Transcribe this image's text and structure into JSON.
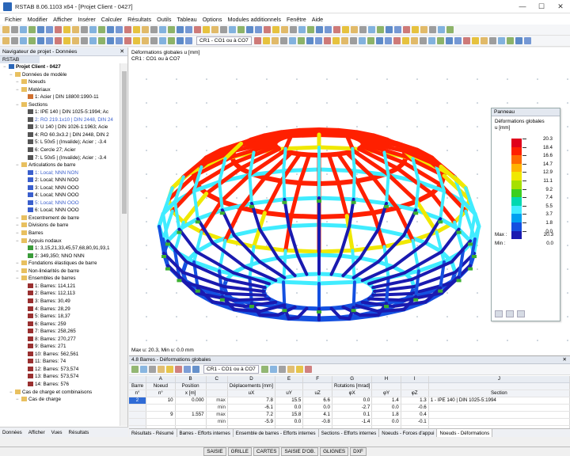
{
  "window": {
    "title": "RSTAB 8.06.1103 x64 - [Projet Client - 0427]"
  },
  "menu": [
    "Fichier",
    "Modifier",
    "Afficher",
    "Insérer",
    "Calculer",
    "Résultats",
    "Outils",
    "Tableau",
    "Options",
    "Modules additionnels",
    "Fenêtre",
    "Aide"
  ],
  "toolbar": {
    "loadcase_combo": "CR1 - CO1 ou à CO7"
  },
  "navigator": {
    "title": "Navigateur de projet - Données",
    "tab": "RSTAB",
    "tree": [
      {
        "depth": 0,
        "label": "Projet Client - 0427",
        "bold": true,
        "icon": "project"
      },
      {
        "depth": 1,
        "label": "Données de modèle",
        "icon": "folder"
      },
      {
        "depth": 2,
        "label": "Noeuds",
        "icon": "folder"
      },
      {
        "depth": 2,
        "label": "Matériaux",
        "icon": "folder"
      },
      {
        "depth": 3,
        "label": "1: Acier | DIN 18800:1990-11",
        "icon": "material"
      },
      {
        "depth": 2,
        "label": "Sections",
        "icon": "folder"
      },
      {
        "depth": 3,
        "label": "1: IPE 140 | DIN 1025-5:1994; Ac",
        "icon": "section"
      },
      {
        "depth": 3,
        "label": "2: RO 219.1x10 | DIN 2448, DIN 24",
        "icon": "section",
        "hl": true
      },
      {
        "depth": 3,
        "label": "3: U 140 | DIN 1026-1:1963; Acie",
        "icon": "section"
      },
      {
        "depth": 3,
        "label": "4: RO 60.3x3.2 | DIN 2448, DIN 2",
        "icon": "section"
      },
      {
        "depth": 3,
        "label": "5: L 50x5 | (Invalide); Acier ; -3.4",
        "icon": "section"
      },
      {
        "depth": 3,
        "label": "6: Cercle 27; Acier",
        "icon": "section"
      },
      {
        "depth": 3,
        "label": "7: L 50x5 | (Invalide); Acier ; -3.4",
        "icon": "section"
      },
      {
        "depth": 2,
        "label": "Articulations de barre",
        "icon": "folder"
      },
      {
        "depth": 3,
        "label": "1: Local; NNN NON",
        "icon": "hinge",
        "hl": true
      },
      {
        "depth": 3,
        "label": "2: Local; NNN NOO",
        "icon": "hinge"
      },
      {
        "depth": 3,
        "label": "3: Local; NNN OOO",
        "icon": "hinge"
      },
      {
        "depth": 3,
        "label": "4: Local; NNN OOO",
        "icon": "hinge"
      },
      {
        "depth": 3,
        "label": "5: Local; NNN OOO",
        "icon": "hinge",
        "hl": true
      },
      {
        "depth": 3,
        "label": "6: Local; NNN OOO",
        "icon": "hinge"
      },
      {
        "depth": 2,
        "label": "Excentrement de barre",
        "icon": "folder"
      },
      {
        "depth": 2,
        "label": "Divisions de barre",
        "icon": "folder"
      },
      {
        "depth": 2,
        "label": "Barres",
        "icon": "folder"
      },
      {
        "depth": 2,
        "label": "Appuis nodaux",
        "icon": "folder"
      },
      {
        "depth": 3,
        "label": "1: 3,15,21,33,45,57,68,80,91,93,1",
        "icon": "support"
      },
      {
        "depth": 3,
        "label": "2: 349,350; NNO NNN",
        "icon": "support"
      },
      {
        "depth": 2,
        "label": "Fondations élastiques de barre",
        "icon": "folder"
      },
      {
        "depth": 2,
        "label": "Non-linéarités de barre",
        "icon": "folder"
      },
      {
        "depth": 2,
        "label": "Ensembles de barres",
        "icon": "folder"
      },
      {
        "depth": 3,
        "label": "1: Barres: 114,121",
        "icon": "set"
      },
      {
        "depth": 3,
        "label": "2: Barres: 112,113",
        "icon": "set"
      },
      {
        "depth": 3,
        "label": "3: Barres: 30,49",
        "icon": "set"
      },
      {
        "depth": 3,
        "label": "4: Barres: 28,29",
        "icon": "set"
      },
      {
        "depth": 3,
        "label": "5: Barres: 18,37",
        "icon": "set"
      },
      {
        "depth": 3,
        "label": "6: Barres: 259",
        "icon": "set"
      },
      {
        "depth": 3,
        "label": "7: Barres: 258,265",
        "icon": "set"
      },
      {
        "depth": 3,
        "label": "8: Barres: 270,277",
        "icon": "set"
      },
      {
        "depth": 3,
        "label": "9: Barres: 271",
        "icon": "set"
      },
      {
        "depth": 3,
        "label": "10: Barres: 562,561",
        "icon": "set"
      },
      {
        "depth": 3,
        "label": "11: Barres: 74",
        "icon": "set"
      },
      {
        "depth": 3,
        "label": "12: Barres: 573,574",
        "icon": "set"
      },
      {
        "depth": 3,
        "label": "13: Barres: 573,574",
        "icon": "set"
      },
      {
        "depth": 3,
        "label": "14: Barres: 576",
        "icon": "set"
      },
      {
        "depth": 1,
        "label": "Cas de charge et combinaisons",
        "icon": "folder"
      },
      {
        "depth": 2,
        "label": "Cas de charge",
        "icon": "folder"
      }
    ],
    "tabs": [
      "Données",
      "Afficher",
      "Vues",
      "Résultats"
    ]
  },
  "view": {
    "caption1": "Déformations globales u [mm]",
    "caption2": "CR1 : CO1 ou à CO7",
    "footer": "Max u: 20.3, Min u: 0.0 mm"
  },
  "panel": {
    "title": "Panneau",
    "subtitle1": "Déformations globales",
    "subtitle2": "u [mm]",
    "legend": [
      {
        "value": "20.3",
        "color": "#e0001b"
      },
      {
        "value": "18.4",
        "color": "#ff2000"
      },
      {
        "value": "16.6",
        "color": "#ff6a00"
      },
      {
        "value": "14.7",
        "color": "#ffb400"
      },
      {
        "value": "12.9",
        "color": "#f0e800"
      },
      {
        "value": "11.1",
        "color": "#a6e000"
      },
      {
        "value": "9.2",
        "color": "#3ccf20"
      },
      {
        "value": "7.4",
        "color": "#00d8b0"
      },
      {
        "value": "5.5",
        "color": "#40ecff"
      },
      {
        "value": "3.7",
        "color": "#00a0f0"
      },
      {
        "value": "1.8",
        "color": "#1450e0"
      },
      {
        "value": "0.0",
        "color": "#1a1ab0"
      }
    ],
    "max_label": "Max :",
    "max_value": "20.3",
    "min_label": "Min :",
    "min_value": "0.0"
  },
  "table": {
    "title": "4.8 Barres - Déformations globales",
    "combo": "CR1 - CO1 ou à CO7",
    "letters": [
      "",
      "A",
      "B",
      "C",
      "D",
      "E",
      "F",
      "G",
      "H",
      "I",
      "J"
    ],
    "headers1": [
      "Barre",
      "Noeud",
      "Position",
      "",
      "Déplacements [mm]",
      "",
      "",
      "Rotations [mrad]",
      "",
      "",
      ""
    ],
    "headers2": [
      "n°",
      "n°",
      "x [m]",
      "",
      "uX",
      "uY",
      "uZ",
      "φX",
      "φY",
      "φZ",
      "Section"
    ],
    "rows": [
      {
        "barre": "2",
        "noeud": "10",
        "pos": "0.000",
        "lab": "max",
        "ux": "7.8",
        "uy": "15.5",
        "uz": "6.6",
        "px": "0.0",
        "py": "1.4",
        "pz": "1.3",
        "sec": "1 - IPE 140 | DIN 1025-5:1994"
      },
      {
        "barre": "",
        "noeud": "",
        "pos": "",
        "lab": "min",
        "ux": "-6.1",
        "uy": "0.0",
        "uz": "0.0",
        "px": "-2.7",
        "py": "0.0",
        "pz": "-0.6",
        "sec": ""
      },
      {
        "barre": "",
        "noeud": "9",
        "pos": "1.557",
        "lab": "max",
        "ux": "7.2",
        "uy": "15.8",
        "uz": "4.1",
        "px": "0.1",
        "py": "1.8",
        "pz": "0.4",
        "sec": ""
      },
      {
        "barre": "",
        "noeud": "",
        "pos": "",
        "lab": "min",
        "ux": "-5.9",
        "uy": "0.0",
        "uz": "-0.8",
        "px": "-1.4",
        "py": "0.0",
        "pz": "-0.1",
        "sec": ""
      }
    ],
    "tabs": [
      "Résultats - Résumé",
      "Barres - Efforts internes",
      "Ensemble de barres - Efforts internes",
      "Sections - Efforts internes",
      "Noeuds - Forces d'appui",
      "Noeuds - Déformations"
    ]
  },
  "status": [
    "SAISIE",
    "GRILLE",
    "CARTES",
    "SAISIE D'OB.",
    "GLIGNES",
    "DXF"
  ]
}
